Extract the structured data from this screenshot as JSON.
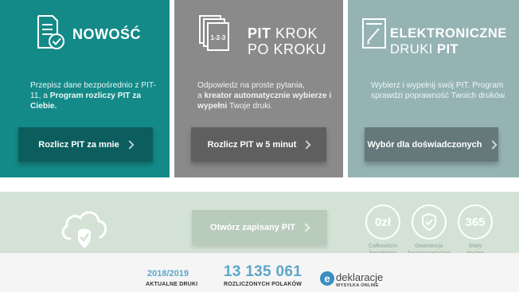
{
  "cards": [
    {
      "title_bold": "NOWOŚĆ",
      "desc_parts": [
        "Przepisz dane bezpośrednio z PIT-11, a ",
        "Program rozliczy PIT za Ciebie."
      ],
      "button": "Rozlicz PIT za mnie",
      "icon": "document-check-icon",
      "color": "#138a88"
    },
    {
      "title_bold": "PIT",
      "title_light_1": "KROK",
      "title_light_2": "PO KROKU",
      "icon_text": "1-2-3",
      "desc_parts": [
        "Odpowiedz na proste pytania,",
        "a ",
        "kreator automatycznie wybierze i wypełni",
        " Twoje druki."
      ],
      "button": "Rozlicz PIT w 5 minut",
      "icon": "stacked-pages-icon",
      "color": "#8a8a8a"
    },
    {
      "title_bold_1": "ELEKTRONICZNE",
      "title_light": "DRUKI",
      "title_bold_2": "PIT",
      "desc": "Wybierz i wypełnij swój PIT. Program sprawdzi poprawność Twoich druków.",
      "button": "Wybór dla doświadczonych",
      "icon": "form-pen-icon",
      "color": "#96b3b4"
    }
  ],
  "band": {
    "open_button": "Otwórz zapisany PIT",
    "cloud_icon": "cloud-check-icon",
    "features": [
      {
        "value": "0zł",
        "label_1": "Całkowicie",
        "label_2": "bezpłatnie"
      },
      {
        "icon": "shield-check-icon",
        "label_1": "Gwarancja",
        "label_2": "bezpieczeństwa"
      },
      {
        "value": "365",
        "label_1": "Stały",
        "label_2": "dostęp"
      }
    ]
  },
  "footer": {
    "year": "2018/2019",
    "year_label": "AKTUALNE DRUKI",
    "count": "13 135 061",
    "count_label": "ROZLICZONYCH POLAKÓW",
    "logo_text": "deklaracje",
    "logo_sub": "WYSYŁKA ONLINE"
  }
}
